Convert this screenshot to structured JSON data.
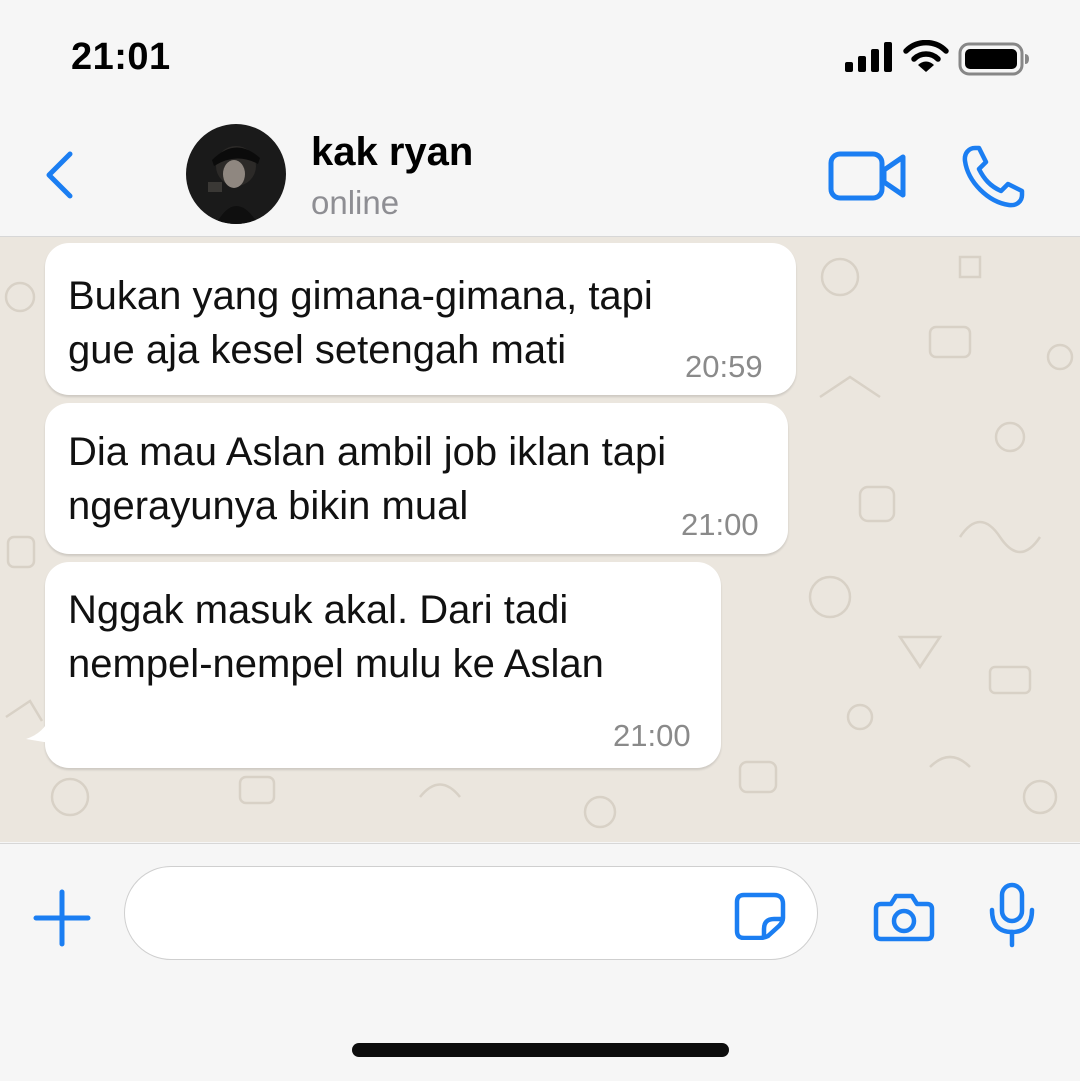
{
  "status_bar": {
    "time": "21:01"
  },
  "header": {
    "contact_name": "kak ryan",
    "contact_status": "online"
  },
  "messages": [
    {
      "lines": [
        "Bukan yang gimana-gimana, tapi",
        "gue aja kesel setengah mati"
      ],
      "time": "20:59"
    },
    {
      "lines": [
        "Dia mau Aslan ambil job iklan tapi",
        "ngerayunya bikin mual"
      ],
      "time": "21:00"
    },
    {
      "lines": [
        "Nggak masuk akal. Dari tadi",
        "nempel-nempel mulu ke Aslan"
      ],
      "time": "21:00"
    }
  ],
  "input": {
    "value": "",
    "placeholder": ""
  },
  "icons": {
    "signal": "signal-icon",
    "wifi": "wifi-icon",
    "battery": "battery-icon",
    "back": "chevron-left-icon",
    "video": "video-camera-icon",
    "call": "phone-icon",
    "plus": "plus-icon",
    "sticker": "sticker-icon",
    "camera": "camera-icon",
    "mic": "microphone-icon"
  },
  "colors": {
    "accent": "#1b7ef2",
    "bubble": "#ffffff",
    "wallpaper": "#ebe6de",
    "bar": "#f6f6f6"
  }
}
